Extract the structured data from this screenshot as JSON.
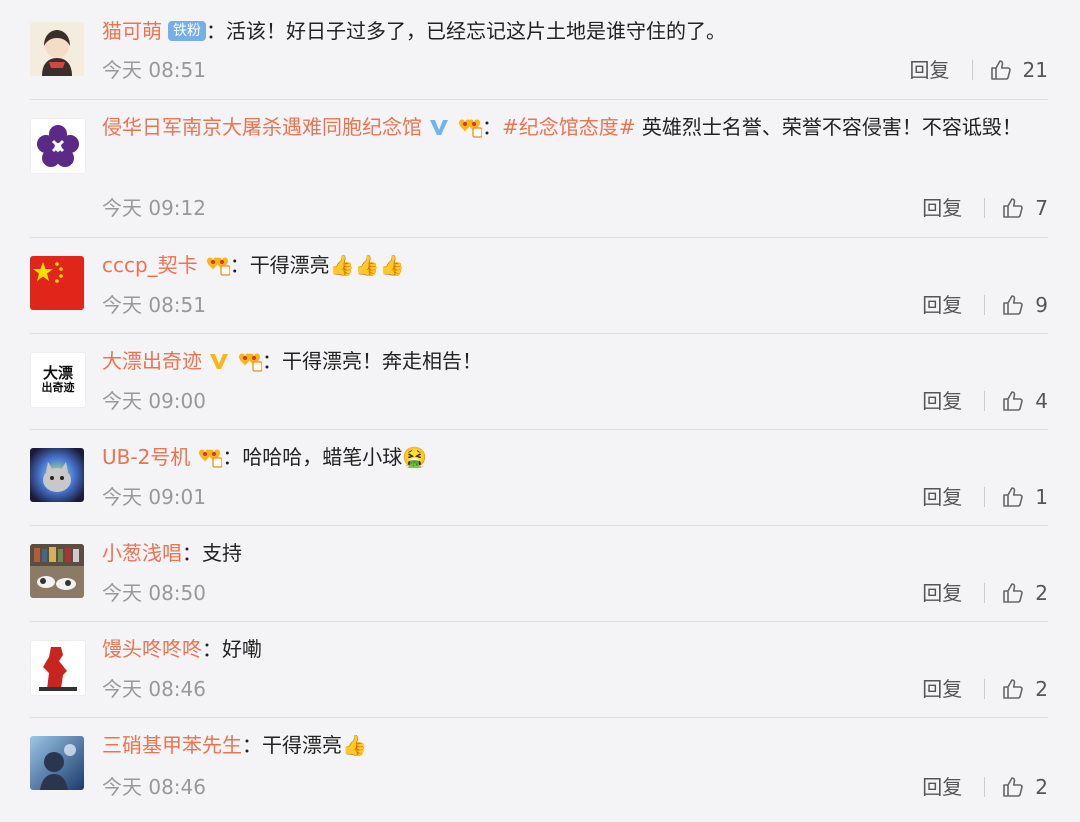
{
  "reply_label": "回复",
  "colors": {
    "username": "#eb7350",
    "fan_badge": "#78aee6",
    "meta_text": "#999999"
  },
  "comments": [
    {
      "user": "猫可萌",
      "badge": "铁粉",
      "sep": "：",
      "text": "活该！好日子过多了，已经忘记这片土地是谁守住的了。",
      "time": "今天 08:51",
      "likes": "21"
    },
    {
      "user": "侵华日军南京大屠杀遇难同胞纪念馆",
      "sep": "：",
      "tag": "#纪念馆态度#",
      "text": " 英雄烈士名誉、荣誉不容侵害！不容诋毁！",
      "time": "今天 09:12",
      "likes": "7"
    },
    {
      "user": "cccp_契卡",
      "sep": "：",
      "text": "干得漂亮👍👍👍",
      "time": "今天 08:51",
      "likes": "9"
    },
    {
      "user": "大漂出奇迹",
      "sep": "：",
      "text": "干得漂亮！奔走相告！",
      "time": "今天 09:00",
      "likes": "4"
    },
    {
      "user": "UB-2号机",
      "sep": "：",
      "text": "哈哈哈，蜡笔小球🤮",
      "time": "今天 09:01",
      "likes": "1"
    },
    {
      "user": "小葱浅唱",
      "sep": "：",
      "text": "支持",
      "time": "今天 08:50",
      "likes": "2"
    },
    {
      "user": "馒头咚咚咚",
      "sep": "：",
      "text": "好嘞",
      "time": "今天 08:46",
      "likes": "2"
    },
    {
      "user": "三硝基甲苯先生",
      "sep": "：",
      "text": "干得漂亮👍",
      "time": "今天 08:46",
      "likes": "2"
    }
  ],
  "avatar_text": {
    "c3_line1": "大漂",
    "c3_line2": "出奇迹"
  }
}
